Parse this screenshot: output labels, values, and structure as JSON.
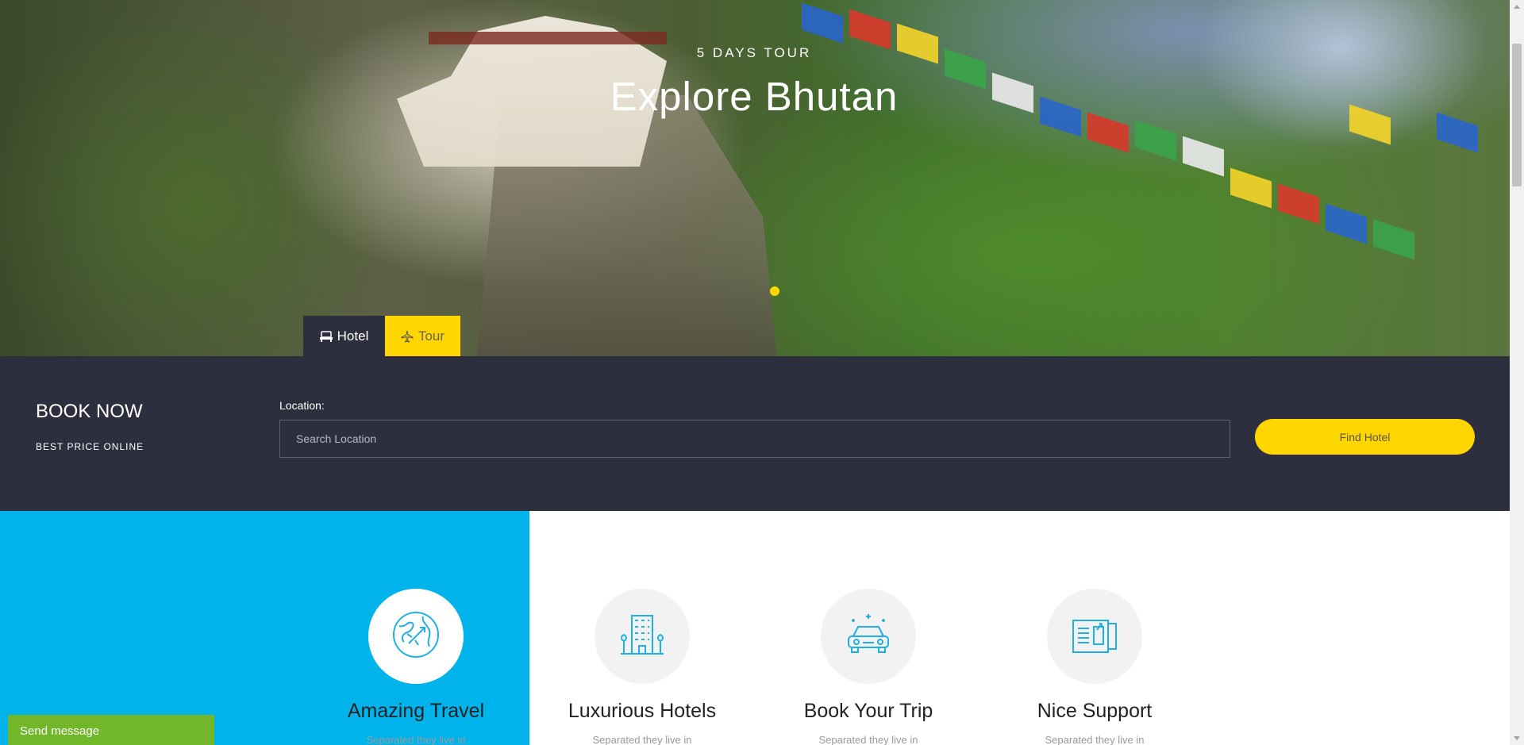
{
  "hero": {
    "subtitle": "5 DAYS TOUR",
    "title": "Explore Bhutan"
  },
  "tabs": [
    {
      "label": "Hotel",
      "icon": "hotel-icon"
    },
    {
      "label": "Tour",
      "icon": "airplane-icon"
    }
  ],
  "booking": {
    "title": "BOOK NOW",
    "subtitle": "BEST PRICE ONLINE",
    "location_label": "Location:",
    "location_placeholder": "Search Location",
    "location_value": "",
    "button_label": "Find Hotel"
  },
  "features": [
    {
      "title": "Amazing Travel",
      "desc": "Separated they live in",
      "icon": "globe-plane-icon"
    },
    {
      "title": "Luxurious Hotels",
      "desc": "Separated they live in",
      "icon": "hotel-building-icon"
    },
    {
      "title": "Book Your Trip",
      "desc": "Separated they live in",
      "icon": "car-icon"
    },
    {
      "title": "Nice Support",
      "desc": "Separated they live in",
      "icon": "support-document-icon"
    }
  ],
  "chat": {
    "label": "Send message"
  },
  "colors": {
    "accent_yellow": "#ffd600",
    "dark_bar": "#2d2f3e",
    "blue_block": "#00b4eb",
    "icon_blue": "#1eb0e6",
    "chat_green": "#72b62a"
  }
}
